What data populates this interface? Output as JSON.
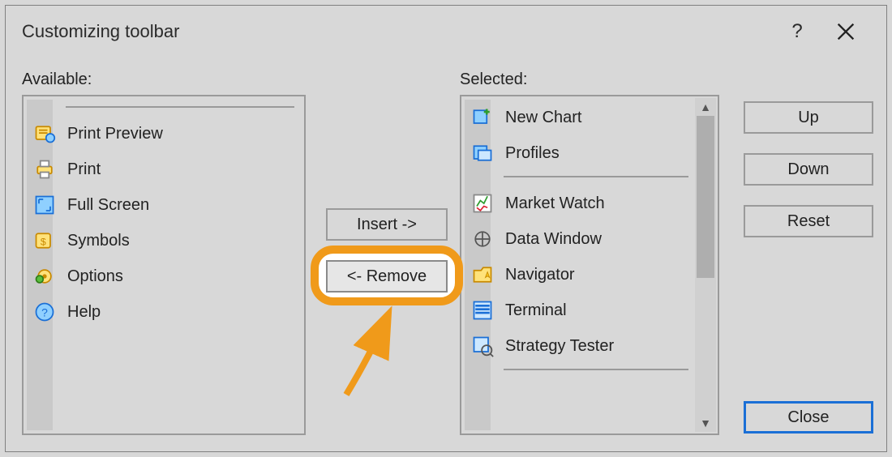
{
  "window": {
    "title": "Customizing toolbar"
  },
  "labels": {
    "available": "Available:",
    "selected": "Selected:"
  },
  "buttons": {
    "insert": "Insert ->",
    "remove": "<- Remove",
    "up": "Up",
    "down": "Down",
    "reset": "Reset",
    "close": "Close"
  },
  "available_items": [
    {
      "label": "Print Preview",
      "icon": "print-preview-icon"
    },
    {
      "label": "Print",
      "icon": "print-icon"
    },
    {
      "label": "Full Screen",
      "icon": "fullscreen-icon"
    },
    {
      "label": "Symbols",
      "icon": "symbols-icon"
    },
    {
      "label": "Options",
      "icon": "options-icon"
    },
    {
      "label": "Help",
      "icon": "help-icon"
    }
  ],
  "selected_items": [
    {
      "label": "New Chart",
      "icon": "new-chart-icon"
    },
    {
      "label": "Profiles",
      "icon": "profiles-icon"
    },
    {
      "label": "Market Watch",
      "icon": "market-watch-icon"
    },
    {
      "label": "Data Window",
      "icon": "data-window-icon"
    },
    {
      "label": "Navigator",
      "icon": "navigator-icon"
    },
    {
      "label": "Terminal",
      "icon": "terminal-icon"
    },
    {
      "label": "Strategy Tester",
      "icon": "strategy-tester-icon"
    }
  ]
}
